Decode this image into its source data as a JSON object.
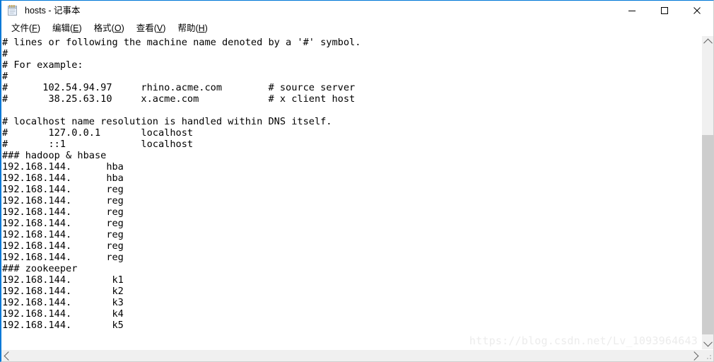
{
  "window": {
    "title": "hosts - 记事本",
    "icon": "notepad-icon",
    "accent_color": "#0078d7",
    "controls": {
      "minimize_label": "—",
      "maximize_label": "□",
      "close_label": "✕"
    }
  },
  "menubar": {
    "items": [
      {
        "label": "文件(F)",
        "text": "文件(",
        "accel": "F",
        "tail": ")"
      },
      {
        "label": "编辑(E)",
        "text": "编辑(",
        "accel": "E",
        "tail": ")"
      },
      {
        "label": "格式(O)",
        "text": "格式(",
        "accel": "O",
        "tail": ")"
      },
      {
        "label": "查看(V)",
        "text": "查看(",
        "accel": "V",
        "tail": ")"
      },
      {
        "label": "帮助(H)",
        "text": "帮助(",
        "accel": "H",
        "tail": ")"
      }
    ]
  },
  "document": {
    "filename": "hosts",
    "lines": [
      "# lines or following the machine name denoted by a '#' symbol.",
      "#",
      "# For example:",
      "#",
      "#      102.54.94.97     rhino.acme.com        # source server",
      "#       38.25.63.10     x.acme.com            # x client host",
      "",
      "# localhost name resolution is handled within DNS itself.",
      "#       127.0.0.1       localhost",
      "#       ::1             localhost",
      "### hadoop & hbase",
      "192.168.144.      hba",
      "192.168.144.      hba",
      "192.168.144.      reg",
      "192.168.144.      reg",
      "192.168.144.      reg",
      "192.168.144.      reg",
      "192.168.144.      reg",
      "192.168.144.      reg",
      "192.168.144.      reg",
      "### zookeeper",
      "192.168.144.       k1",
      "192.168.144.       k2",
      "192.168.144.       k3",
      "192.168.144.       k4",
      "192.168.144.       k5"
    ]
  },
  "scrollbars": {
    "vertical": {
      "up_arrow": "chevron-up-icon",
      "down_arrow": "chevron-down-icon",
      "thumb_top_pct": 30,
      "thumb_height_pct": 69
    },
    "horizontal": {
      "left_arrow": "chevron-left-icon",
      "right_arrow": "chevron-right-icon",
      "thumb_left_pct": 0,
      "thumb_width_pct": 100
    },
    "resize_grip": "resize-grip-icon"
  },
  "watermark": {
    "text": "https://blog.csdn.net/Lv_1093964643"
  }
}
